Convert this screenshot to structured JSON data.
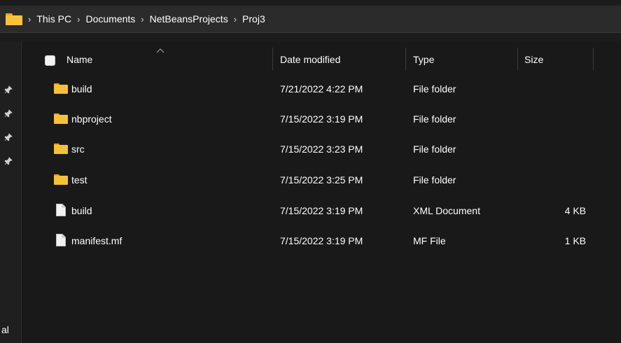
{
  "address_bar": {
    "crumbs": [
      "This PC",
      "Documents",
      "NetBeansProjects",
      "Proj3"
    ]
  },
  "left_nav": {
    "partial_text": "al"
  },
  "columns": {
    "name": "Name",
    "date": "Date modified",
    "type": "Type",
    "size": "Size"
  },
  "files": [
    {
      "name": "build",
      "date": "7/21/2022 4:22 PM",
      "type": "File folder",
      "size": "",
      "icon": "folder-icon"
    },
    {
      "name": "nbproject",
      "date": "7/15/2022 3:19 PM",
      "type": "File folder",
      "size": "",
      "icon": "folder-icon"
    },
    {
      "name": "src",
      "date": "7/15/2022 3:23 PM",
      "type": "File folder",
      "size": "",
      "icon": "folder-icon"
    },
    {
      "name": "test",
      "date": "7/15/2022 3:25 PM",
      "type": "File folder",
      "size": "",
      "icon": "folder-icon"
    },
    {
      "name": "build",
      "date": "7/15/2022 3:19 PM",
      "type": "XML Document",
      "size": "4 KB",
      "icon": "file-icon"
    },
    {
      "name": "manifest.mf",
      "date": "7/15/2022 3:19 PM",
      "type": "MF File",
      "size": "1 KB",
      "icon": "file-icon"
    }
  ],
  "colors": {
    "background": "#191919",
    "folder": "#f6c13a",
    "text": "#ffffff"
  }
}
